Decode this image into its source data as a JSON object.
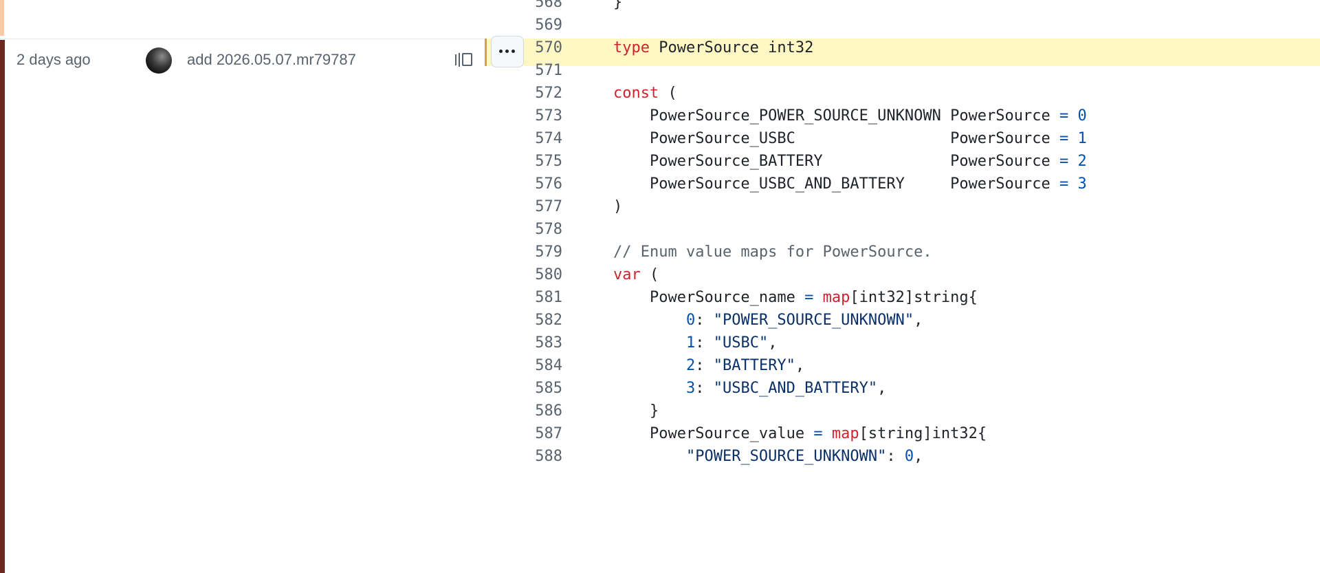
{
  "blame": {
    "age": "2 days ago",
    "commit_message": "add 2026.05.07.mr79787"
  },
  "code": {
    "lines": [
      {
        "num": "568",
        "tokens": [
          {
            "t": "}",
            "c": "plain"
          }
        ]
      },
      {
        "num": "569",
        "tokens": []
      },
      {
        "num": "570",
        "tokens": [
          {
            "t": "type",
            "c": "kw"
          },
          {
            "t": " PowerSource int32",
            "c": "plain"
          }
        ]
      },
      {
        "num": "571",
        "tokens": []
      },
      {
        "num": "572",
        "tokens": [
          {
            "t": "const",
            "c": "kw"
          },
          {
            "t": " (",
            "c": "plain"
          }
        ]
      },
      {
        "num": "573",
        "tokens": [
          {
            "t": "    PowerSource_POWER_SOURCE_UNKNOWN PowerSource ",
            "c": "plain"
          },
          {
            "t": "=",
            "c": "op"
          },
          {
            "t": " ",
            "c": "plain"
          },
          {
            "t": "0",
            "c": "num"
          }
        ]
      },
      {
        "num": "574",
        "tokens": [
          {
            "t": "    PowerSource_USBC                 PowerSource ",
            "c": "plain"
          },
          {
            "t": "=",
            "c": "op"
          },
          {
            "t": " ",
            "c": "plain"
          },
          {
            "t": "1",
            "c": "num"
          }
        ]
      },
      {
        "num": "575",
        "tokens": [
          {
            "t": "    PowerSource_BATTERY              PowerSource ",
            "c": "plain"
          },
          {
            "t": "=",
            "c": "op"
          },
          {
            "t": " ",
            "c": "plain"
          },
          {
            "t": "2",
            "c": "num"
          }
        ]
      },
      {
        "num": "576",
        "tokens": [
          {
            "t": "    PowerSource_USBC_AND_BATTERY     PowerSource ",
            "c": "plain"
          },
          {
            "t": "=",
            "c": "op"
          },
          {
            "t": " ",
            "c": "plain"
          },
          {
            "t": "3",
            "c": "num"
          }
        ]
      },
      {
        "num": "577",
        "tokens": [
          {
            "t": ")",
            "c": "plain"
          }
        ]
      },
      {
        "num": "578",
        "tokens": []
      },
      {
        "num": "579",
        "tokens": [
          {
            "t": "// Enum value maps for PowerSource.",
            "c": "cm"
          }
        ]
      },
      {
        "num": "580",
        "tokens": [
          {
            "t": "var",
            "c": "kw"
          },
          {
            "t": " (",
            "c": "plain"
          }
        ]
      },
      {
        "num": "581",
        "tokens": [
          {
            "t": "    PowerSource_name ",
            "c": "plain"
          },
          {
            "t": "=",
            "c": "op"
          },
          {
            "t": " ",
            "c": "plain"
          },
          {
            "t": "map",
            "c": "kw"
          },
          {
            "t": "[int32]string{",
            "c": "plain"
          }
        ]
      },
      {
        "num": "582",
        "tokens": [
          {
            "t": "        ",
            "c": "plain"
          },
          {
            "t": "0",
            "c": "num"
          },
          {
            "t": ": ",
            "c": "plain"
          },
          {
            "t": "\"POWER_SOURCE_UNKNOWN\"",
            "c": "str"
          },
          {
            "t": ",",
            "c": "plain"
          }
        ]
      },
      {
        "num": "583",
        "tokens": [
          {
            "t": "        ",
            "c": "plain"
          },
          {
            "t": "1",
            "c": "num"
          },
          {
            "t": ": ",
            "c": "plain"
          },
          {
            "t": "\"USBC\"",
            "c": "str"
          },
          {
            "t": ",",
            "c": "plain"
          }
        ]
      },
      {
        "num": "584",
        "tokens": [
          {
            "t": "        ",
            "c": "plain"
          },
          {
            "t": "2",
            "c": "num"
          },
          {
            "t": ": ",
            "c": "plain"
          },
          {
            "t": "\"BATTERY\"",
            "c": "str"
          },
          {
            "t": ",",
            "c": "plain"
          }
        ]
      },
      {
        "num": "585",
        "tokens": [
          {
            "t": "        ",
            "c": "plain"
          },
          {
            "t": "3",
            "c": "num"
          },
          {
            "t": ": ",
            "c": "plain"
          },
          {
            "t": "\"USBC_AND_BATTERY\"",
            "c": "str"
          },
          {
            "t": ",",
            "c": "plain"
          }
        ]
      },
      {
        "num": "586",
        "tokens": [
          {
            "t": "    }",
            "c": "plain"
          }
        ]
      },
      {
        "num": "587",
        "tokens": [
          {
            "t": "    PowerSource_value ",
            "c": "plain"
          },
          {
            "t": "=",
            "c": "op"
          },
          {
            "t": " ",
            "c": "plain"
          },
          {
            "t": "map",
            "c": "kw"
          },
          {
            "t": "[string]int32{",
            "c": "plain"
          }
        ]
      },
      {
        "num": "588",
        "tokens": [
          {
            "t": "        ",
            "c": "plain"
          },
          {
            "t": "\"POWER_SOURCE_UNKNOWN\"",
            "c": "str"
          },
          {
            "t": ": ",
            "c": "plain"
          },
          {
            "t": "0",
            "c": "num"
          },
          {
            "t": ",",
            "c": "plain"
          }
        ]
      }
    ]
  },
  "colors": {
    "keyword": "#cf222e",
    "number": "#0550ae",
    "string": "#0a3069",
    "comment": "#59636e",
    "highlight": "#fff8c5",
    "blame_age_current": "#6a2a22",
    "blame_age_previous": "#f8c9a3"
  },
  "icons": {
    "reblame": "reblame-icon",
    "more": "kebab-horizontal-icon",
    "avatar": "avatar"
  }
}
